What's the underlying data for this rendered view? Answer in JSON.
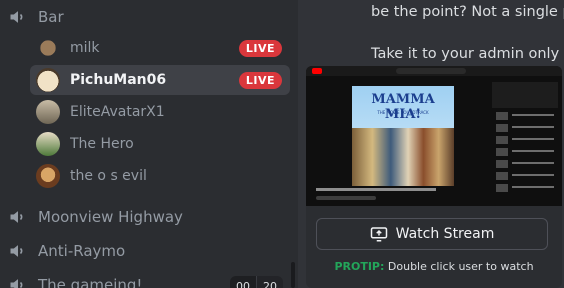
{
  "sidebar": {
    "top_channel": "Bar",
    "users": [
      {
        "name": "milk",
        "live": "LIVE"
      },
      {
        "name": "PichuMan06",
        "live": "LIVE"
      },
      {
        "name": "EliteAvatarX1"
      },
      {
        "name": "The Hero"
      },
      {
        "name": "the o s evil"
      }
    ],
    "channels": [
      {
        "name": "Moonview Highway"
      },
      {
        "name": "Anti-Raymo"
      },
      {
        "name": "The gameing!"
      }
    ],
    "counter": {
      "left": "00",
      "right": "20"
    }
  },
  "chat": {
    "line1": "be the point? Not a single pe",
    "line2": "Take it to your admin only ch"
  },
  "stream": {
    "poster_title": "MAMMA MIA!",
    "poster_subtitle": "THE MOVIE SOUNDTRACK",
    "watch_label": "Watch Stream",
    "protip_label": "PROTIP:",
    "protip_text": "Double click user to watch"
  },
  "colors": {
    "live": "#da373c",
    "protip": "#23a55a",
    "sidebar_bg": "#2b2d31",
    "main_bg": "#313338"
  }
}
